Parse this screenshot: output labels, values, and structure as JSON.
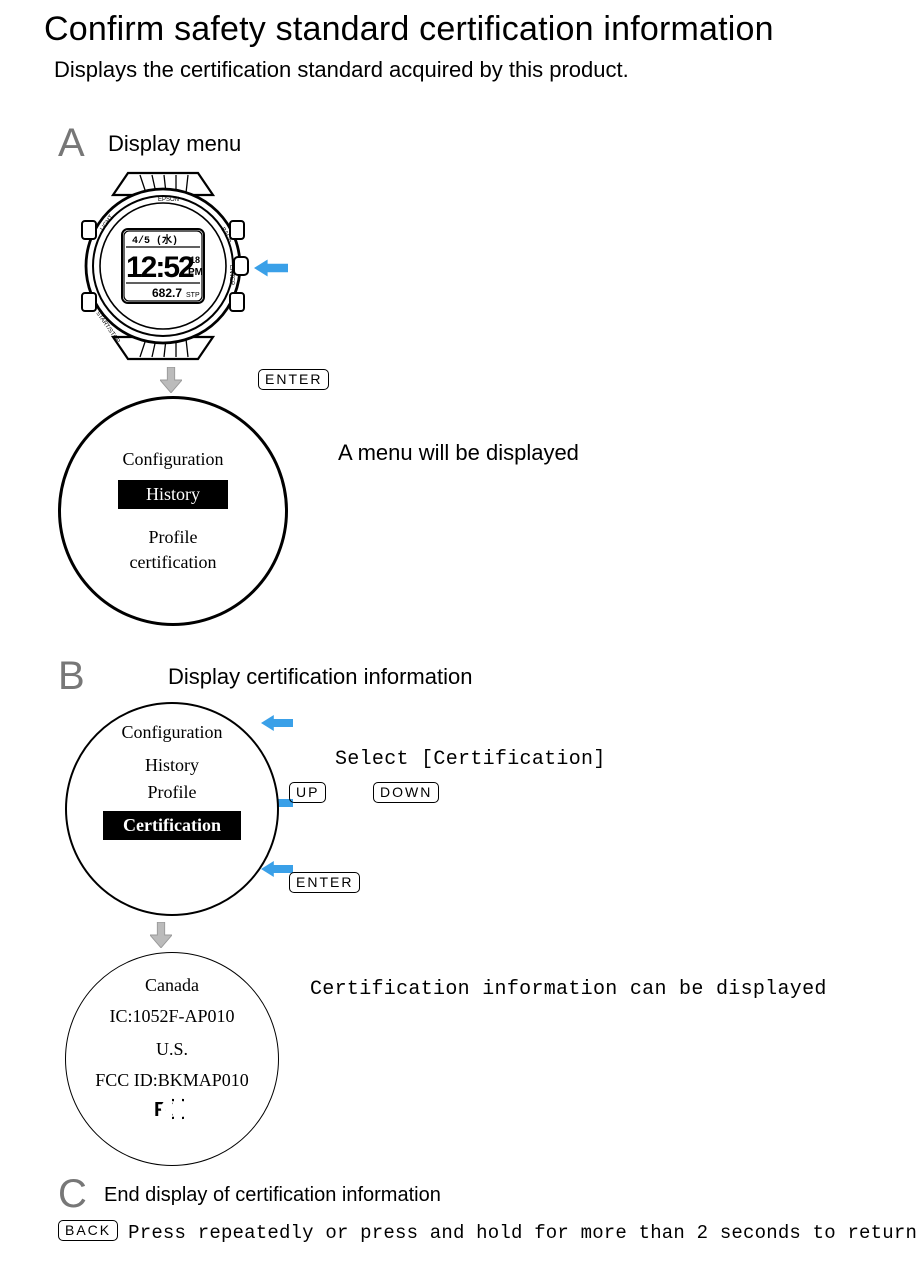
{
  "title": "Confirm safety standard certification information",
  "subtitle": "Displays the certification standard acquired by this product.",
  "steps": {
    "A": {
      "letter": "A",
      "title": "Display menu",
      "button": "ENTER",
      "menu": {
        "item1": "Configuration",
        "selected": "History",
        "item2": "Profile",
        "item3": "certification"
      },
      "side": "A menu will be displayed"
    },
    "B": {
      "letter": "B",
      "title": "Display certification information",
      "select_text": "Select [Certification]",
      "btn_up": "UP",
      "btn_down": "DOWN",
      "btn_enter": "ENTER",
      "menu": {
        "item1": "Configuration",
        "item2": "History",
        "item3": "Profile",
        "selected": "Certification"
      },
      "cert": {
        "l1": "Canada",
        "l2": "IC:1052F-AP010",
        "l3": "U.S.",
        "l4": "FCC ID:BKMAP010"
      },
      "cert_side": "Certification information can be displayed"
    },
    "C": {
      "letter": "C",
      "title": "End display of certification information",
      "btn_back": "BACK",
      "text": "Press repeatedly or press and hold for more than 2 seconds to return to the clock screen"
    }
  },
  "watch_screen": {
    "date": "4/5 (水)",
    "time": "12:52",
    "sec": "18",
    "ampm": "PM",
    "step": "682.7",
    "unit": "STP"
  }
}
